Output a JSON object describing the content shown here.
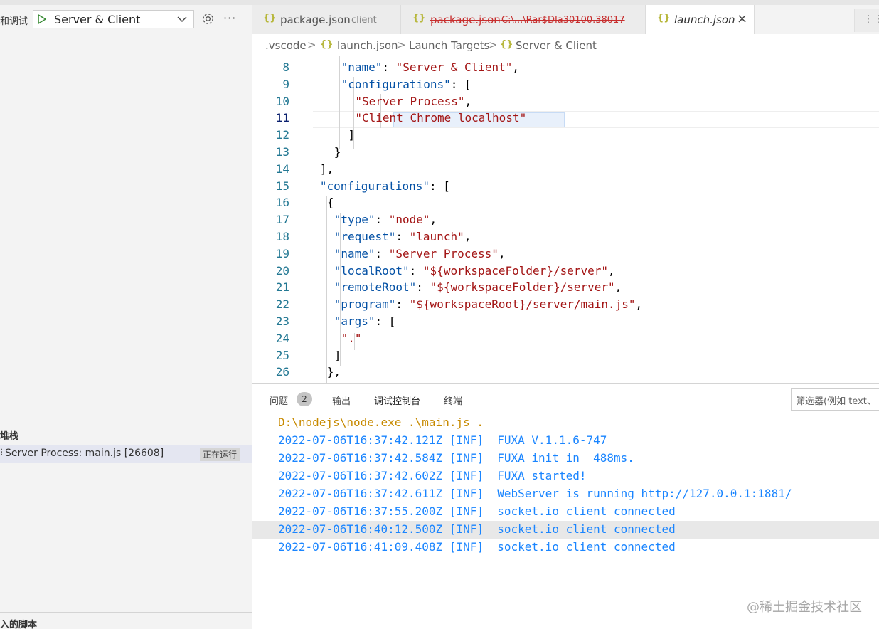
{
  "sidebar": {
    "title": "和调试",
    "launch_config": "Server & Client",
    "call_stack_title": "堆栈",
    "thread_label": "Server Process: main.js [26608]",
    "thread_status": "正在运行",
    "loaded_scripts_title": "入的脚本"
  },
  "tabs": [
    {
      "name": "package.json",
      "desc": "client"
    },
    {
      "name": "package.json",
      "desc": "C:\\...\\Rar$DIa30100.38017"
    },
    {
      "name": "launch.json",
      "desc": ""
    }
  ],
  "breadcrumb": [
    ".vscode",
    "launch.json",
    "Launch Targets",
    "Server & Client"
  ],
  "icons": {
    "json": "{}",
    "close": "×",
    "more": "···",
    "split": "⋮⋮",
    "chevron": ">"
  },
  "editor": {
    "current_line": "11",
    "lines": [
      {
        "n": "8",
        "key": "\"name\"",
        "sep": ": ",
        "val": "\"Server & Client\"",
        "end": ","
      },
      {
        "n": "9",
        "key": "\"configurations\"",
        "sep": ": ",
        "val": "",
        "end": "["
      },
      {
        "n": "10",
        "key": "",
        "sep": "",
        "val": "\"Server Process\"",
        "end": ","
      },
      {
        "n": "11",
        "key": "",
        "sep": "",
        "val": "\"Client Chrome localhost\"",
        "end": ""
      },
      {
        "n": "12",
        "key": "",
        "sep": "",
        "val": "",
        "end": "]"
      },
      {
        "n": "13",
        "key": "",
        "sep": "",
        "val": "",
        "end": "}"
      },
      {
        "n": "14",
        "key": "",
        "sep": "",
        "val": "",
        "end": "],"
      },
      {
        "n": "15",
        "key": "\"configurations\"",
        "sep": ": ",
        "val": "",
        "end": "["
      },
      {
        "n": "16",
        "key": "",
        "sep": "",
        "val": "",
        "end": "{"
      },
      {
        "n": "17",
        "key": "\"type\"",
        "sep": ": ",
        "val": "\"node\"",
        "end": ","
      },
      {
        "n": "18",
        "key": "\"request\"",
        "sep": ": ",
        "val": "\"launch\"",
        "end": ","
      },
      {
        "n": "19",
        "key": "\"name\"",
        "sep": ": ",
        "val": "\"Server Process\"",
        "end": ","
      },
      {
        "n": "20",
        "key": "\"localRoot\"",
        "sep": ": ",
        "val": "\"${workspaceFolder}/server\"",
        "end": ","
      },
      {
        "n": "21",
        "key": "\"remoteRoot\"",
        "sep": ": ",
        "val": "\"${workspaceFolder}/server\"",
        "end": ","
      },
      {
        "n": "22",
        "key": "\"program\"",
        "sep": ": ",
        "val": "\"${workspaceRoot}/server/main.js\"",
        "end": ","
      },
      {
        "n": "23",
        "key": "\"args\"",
        "sep": ": ",
        "val": "",
        "end": "["
      },
      {
        "n": "24",
        "key": "",
        "sep": "",
        "val": "\".\"",
        "end": ""
      },
      {
        "n": "25",
        "key": "",
        "sep": "",
        "val": "",
        "end": "]"
      },
      {
        "n": "26",
        "key": "",
        "sep": "",
        "val": "",
        "end": "},"
      }
    ]
  },
  "panel": {
    "tabs": [
      "问题",
      "输出",
      "调试控制台",
      "终端"
    ],
    "problems_count": "2",
    "filter_placeholder": "筛选器(例如 text、",
    "command": "D:\\nodejs\\node.exe .\\main.js .",
    "output": [
      "2022-07-06T16:37:42.121Z [INF]  FUXA V.1.1.6-747",
      "2022-07-06T16:37:42.584Z [INF]  FUXA init in  488ms.",
      "2022-07-06T16:37:42.602Z [INF]  FUXA started!",
      "2022-07-06T16:37:42.611Z [INF]  WebServer is running http://127.0.0.1:1881/",
      "2022-07-06T16:37:55.200Z [INF]  socket.io client connected",
      "2022-07-06T16:40:12.500Z [INF]  socket.io client connected",
      "2022-07-06T16:41:09.408Z [INF]  socket.io client connected"
    ],
    "watermark": "@稀土掘金技术社区"
  },
  "colors": {
    "key": "#0451a5",
    "string": "#a31515",
    "line_number": "#237893",
    "console_text": "#1a85ff",
    "console_cmd": "#c78a00"
  }
}
